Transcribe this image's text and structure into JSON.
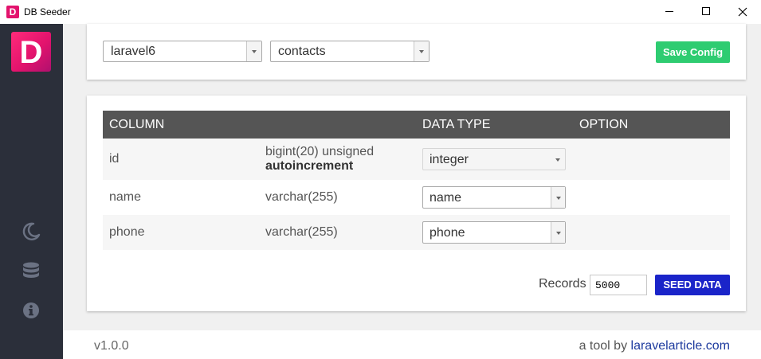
{
  "window": {
    "title": "DB Seeder",
    "app_icon_letter": "D"
  },
  "sidebar": {
    "logo_letter": "D",
    "icons": [
      "moon-icon",
      "database-icon",
      "info-icon"
    ]
  },
  "config": {
    "database_selected": "laravel6",
    "table_selected": "contacts",
    "save_label": "Save Config"
  },
  "table": {
    "headers": {
      "column": "COLUMN",
      "data_type": "DATA TYPE",
      "option": "OPTION"
    },
    "rows": [
      {
        "column": "id",
        "type": "bigint(20) unsigned",
        "type_extra": "autoincrement",
        "data_type": "integer",
        "disabled": true
      },
      {
        "column": "name",
        "type": "varchar(255)",
        "type_extra": "",
        "data_type": "name",
        "disabled": false
      },
      {
        "column": "phone",
        "type": "varchar(255)",
        "type_extra": "",
        "data_type": "phone",
        "disabled": false
      }
    ]
  },
  "seed": {
    "records_label": "Records",
    "records_value": "5000",
    "seed_label": "SEED DATA"
  },
  "footer": {
    "version": "v1.0.0",
    "credit_prefix": "a tool by",
    "credit_link": "laravelarticle.com"
  },
  "colors": {
    "sidebar_bg": "#2b2f3a",
    "save_button": "#2ecc71",
    "seed_button": "#1a24c9",
    "header_bg": "#555555",
    "brand": "#e3136d"
  }
}
